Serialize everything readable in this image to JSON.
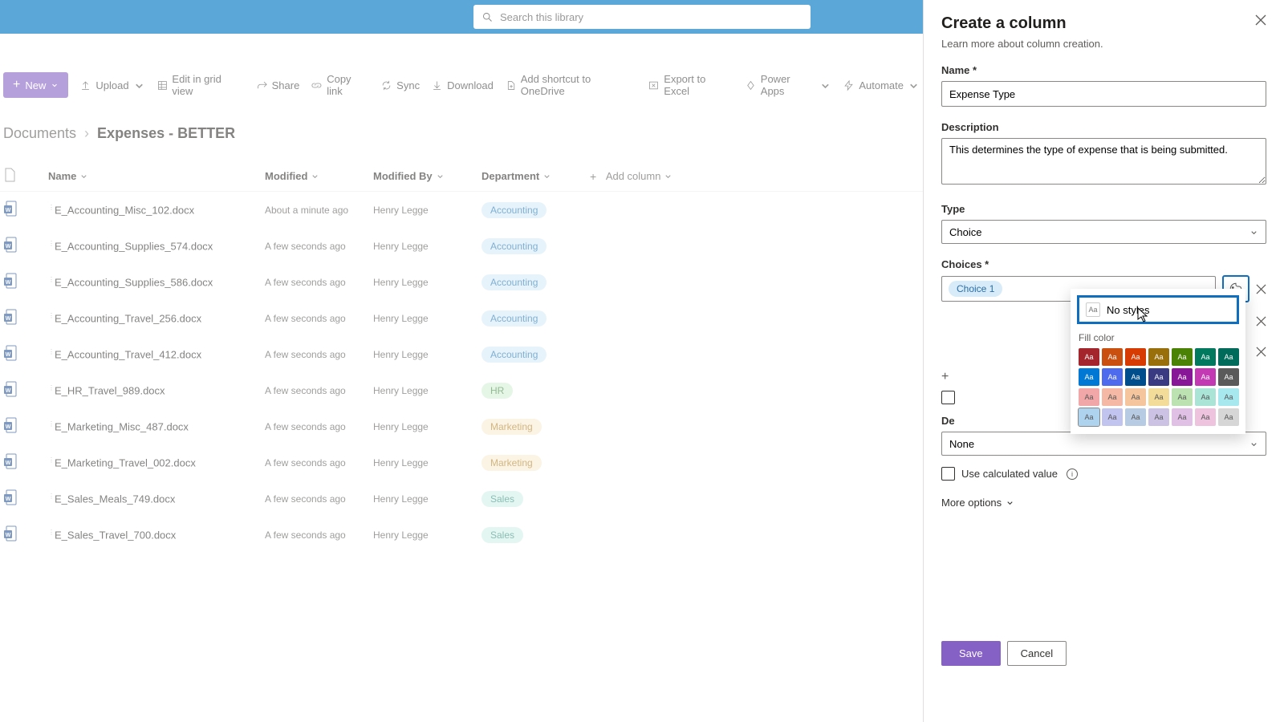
{
  "search": {
    "placeholder": "Search this library"
  },
  "toolbar": {
    "new": "New",
    "upload": "Upload",
    "edit_grid": "Edit in grid view",
    "share": "Share",
    "copy_link": "Copy link",
    "sync": "Sync",
    "download": "Download",
    "shortcut": "Add shortcut to OneDrive",
    "export": "Export to Excel",
    "power_apps": "Power Apps",
    "automate": "Automate"
  },
  "breadcrumb": {
    "root": "Documents",
    "current": "Expenses - BETTER"
  },
  "columns": {
    "name": "Name",
    "modified": "Modified",
    "modified_by": "Modified By",
    "department": "Department",
    "add": "Add column"
  },
  "rows": [
    {
      "file": "E_Accounting_Misc_102.docx",
      "modified": "About a minute ago",
      "by": "Henry Legge",
      "dept": "Accounting",
      "pill": "accounting"
    },
    {
      "file": "E_Accounting_Supplies_574.docx",
      "modified": "A few seconds ago",
      "by": "Henry Legge",
      "dept": "Accounting",
      "pill": "accounting"
    },
    {
      "file": "E_Accounting_Supplies_586.docx",
      "modified": "A few seconds ago",
      "by": "Henry Legge",
      "dept": "Accounting",
      "pill": "accounting"
    },
    {
      "file": "E_Accounting_Travel_256.docx",
      "modified": "A few seconds ago",
      "by": "Henry Legge",
      "dept": "Accounting",
      "pill": "accounting"
    },
    {
      "file": "E_Accounting_Travel_412.docx",
      "modified": "A few seconds ago",
      "by": "Henry Legge",
      "dept": "Accounting",
      "pill": "accounting"
    },
    {
      "file": "E_HR_Travel_989.docx",
      "modified": "A few seconds ago",
      "by": "Henry Legge",
      "dept": "HR",
      "pill": "hr"
    },
    {
      "file": "E_Marketing_Misc_487.docx",
      "modified": "A few seconds ago",
      "by": "Henry Legge",
      "dept": "Marketing",
      "pill": "marketing"
    },
    {
      "file": "E_Marketing_Travel_002.docx",
      "modified": "A few seconds ago",
      "by": "Henry Legge",
      "dept": "Marketing",
      "pill": "marketing"
    },
    {
      "file": "E_Sales_Meals_749.docx",
      "modified": "A few seconds ago",
      "by": "Henry Legge",
      "dept": "Sales",
      "pill": "sales"
    },
    {
      "file": "E_Sales_Travel_700.docx",
      "modified": "A few seconds ago",
      "by": "Henry Legge",
      "dept": "Sales",
      "pill": "sales"
    }
  ],
  "panel": {
    "title": "Create a column",
    "subtitle": "Learn more about column creation.",
    "name_label": "Name *",
    "name_value": "Expense Type",
    "desc_label": "Description",
    "desc_value": "This determines the type of expense that is being submitted.",
    "type_label": "Type",
    "type_value": "Choice",
    "choices_label": "Choices *",
    "choice1": "Choice 1",
    "default_label_partial": "De",
    "default_value": "None",
    "use_calc": "Use calculated value",
    "more": "More options",
    "save": "Save",
    "cancel": "Cancel"
  },
  "color_popup": {
    "no_styles": "No styles",
    "fill_color": "Fill color",
    "swatch_text": "Aa",
    "rows": [
      [
        "#a4262c",
        "#ca5010",
        "#d83b01",
        "#986f0b",
        "#498205",
        "#00795e",
        "#006b5b"
      ],
      [
        "#0078d4",
        "#4f6bed",
        "#004e8c",
        "#393a82",
        "#881798",
        "#c239b3",
        "#5a5a5a"
      ],
      [
        "#f1a7a7",
        "#f4b8a4",
        "#f5c69d",
        "#f3dc99",
        "#bce2b1",
        "#a9e4d6",
        "#a6e8ee"
      ],
      [
        "#aed3ef",
        "#c1c4ee",
        "#b7cbe2",
        "#cbc2e4",
        "#e1c0e6",
        "#edc3de",
        "#d6d6d6"
      ]
    ]
  }
}
